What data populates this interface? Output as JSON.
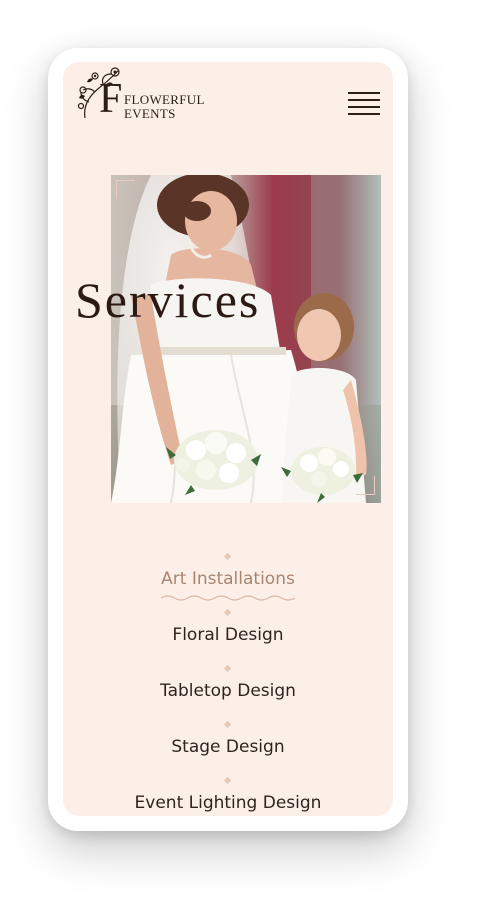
{
  "brand": {
    "initial": "F",
    "line1": "FLOWERFUL",
    "line2": "EVENTS"
  },
  "hero": {
    "title": "Services"
  },
  "nav": {
    "items": [
      {
        "label": "Art Installations",
        "active": true
      },
      {
        "label": "Floral Design",
        "active": false
      },
      {
        "label": "Tabletop Design",
        "active": false
      },
      {
        "label": "Stage Design",
        "active": false
      },
      {
        "label": "Event Lighting Design",
        "active": false
      }
    ]
  },
  "colors": {
    "background": "#fbefe8",
    "text": "#2d2420",
    "accent": "#a88570",
    "diamond": "#e4c9b5"
  },
  "icons": {
    "menu": "hamburger-icon",
    "logo": "floral-logo-icon"
  }
}
